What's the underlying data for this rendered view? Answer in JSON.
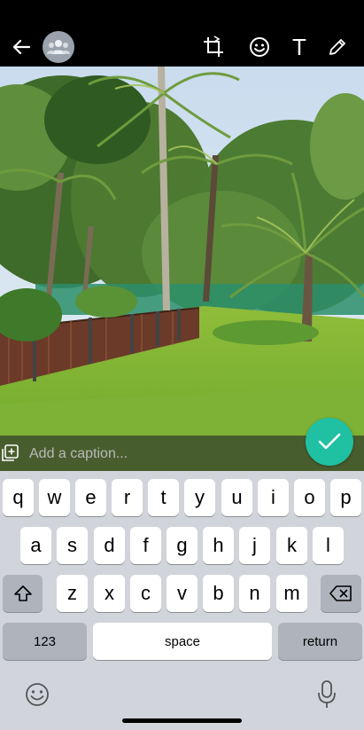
{
  "topbar": {
    "icons": [
      "back-arrow-icon",
      "group-avatar-icon",
      "crop-rotate-icon",
      "sticker-icon",
      "text-icon",
      "pencil-icon"
    ],
    "text_tool_label": "T"
  },
  "caption": {
    "placeholder": "Add a caption..."
  },
  "colors": {
    "send_accent": "#20c0a3",
    "keyboard_bg": "#d1d4da",
    "fn_key_bg": "#aeb3bc"
  },
  "keyboard": {
    "row1": [
      "q",
      "w",
      "e",
      "r",
      "t",
      "y",
      "u",
      "i",
      "o",
      "p"
    ],
    "row2": [
      "a",
      "s",
      "d",
      "f",
      "g",
      "h",
      "j",
      "k",
      "l"
    ],
    "row3": [
      "z",
      "x",
      "c",
      "v",
      "b",
      "n",
      "m"
    ],
    "numbers_label": "123",
    "space_label": "space",
    "return_label": "return"
  }
}
